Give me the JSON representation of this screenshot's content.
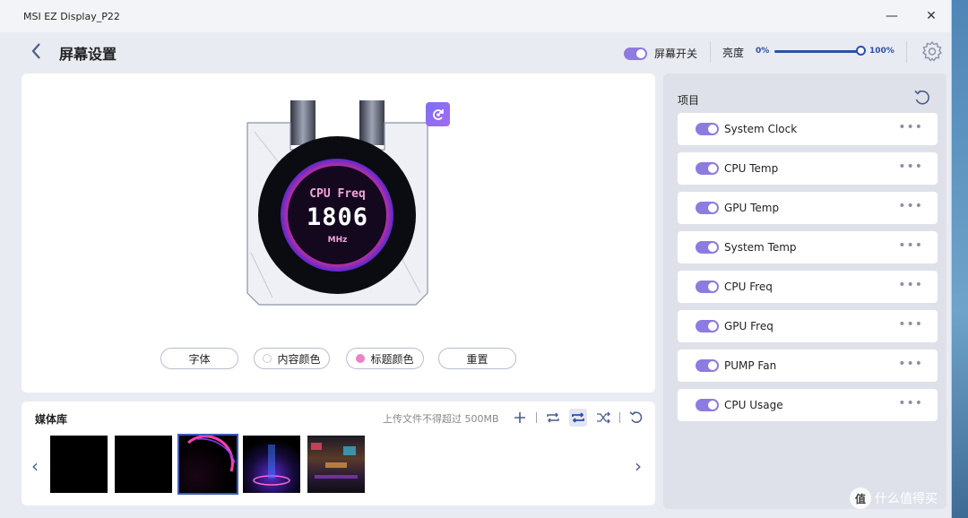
{
  "window": {
    "title": "MSI EZ Display_P22",
    "minimize": "—",
    "close": "✕"
  },
  "header": {
    "page_title": "屏幕设置",
    "screen_switch_label": "屏幕开关",
    "brightness_label": "亮度",
    "brightness_min": "0%",
    "brightness_max": "100%",
    "brightness_value": 1.0
  },
  "preview": {
    "screen_title": "CPU Freq",
    "screen_value": "1806",
    "screen_unit": "MHz",
    "buttons": [
      {
        "label": "字体",
        "dot": ""
      },
      {
        "label": "内容颜色",
        "dot": "#ffffff"
      },
      {
        "label": "标题颜色",
        "dot": "#f27fc8"
      },
      {
        "label": "重置",
        "dot": ""
      }
    ]
  },
  "media": {
    "title": "媒体库",
    "upload_note": "上传文件不得超过 500MB",
    "prev": "‹",
    "next": "›",
    "selected_index": 2
  },
  "items_panel": {
    "title": "项目",
    "items": [
      {
        "label": "System Clock",
        "enabled": true
      },
      {
        "label": "CPU Temp",
        "enabled": true
      },
      {
        "label": "GPU Temp",
        "enabled": true
      },
      {
        "label": "System Temp",
        "enabled": true
      },
      {
        "label": "CPU Freq",
        "enabled": true
      },
      {
        "label": "GPU Freq",
        "enabled": true
      },
      {
        "label": "PUMP Fan",
        "enabled": true
      },
      {
        "label": "CPU Usage",
        "enabled": true
      }
    ],
    "more": "•••"
  },
  "watermark": {
    "logo": "值",
    "text": "什么值得买"
  },
  "colors": {
    "accent": "#8e7be0",
    "brand_blue": "#2d4fa6"
  }
}
